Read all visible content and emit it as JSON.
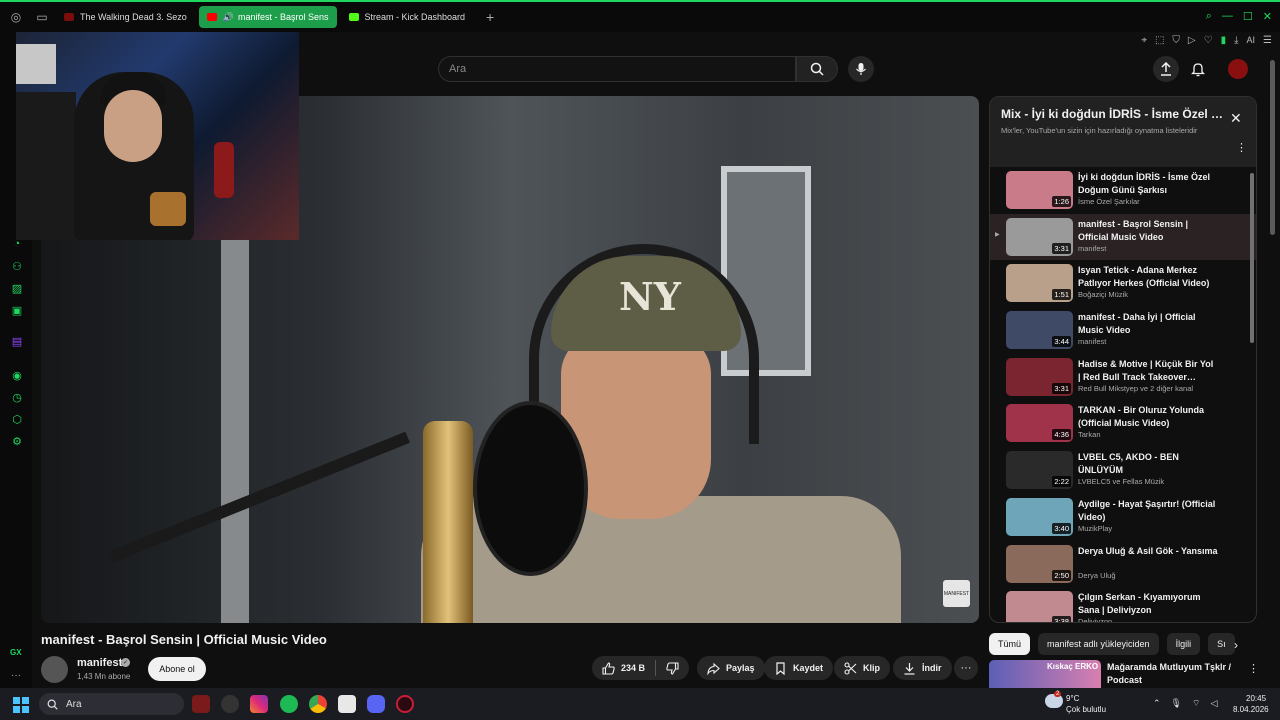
{
  "browser": {
    "tabs": [
      {
        "label": "The Walking Dead 3. Sezo",
        "active": false,
        "favicon_color": "#7a0c0c"
      },
      {
        "label": "manifest - Başrol Sens",
        "active": true,
        "favicon_color": "#ff0000"
      },
      {
        "label": "Stream - Kick Dashboard",
        "active": false,
        "favicon_color": "#53fc18"
      }
    ],
    "toolbar_ai_label": "AI",
    "accent": "#1fd65f"
  },
  "sidebar": {
    "gx_label": "GX",
    "more_label": "···"
  },
  "youtube": {
    "search_placeholder": "Ara",
    "video": {
      "title": "manifest - Başrol Sensin | Official Music Video",
      "watermark": "MANIFEST"
    },
    "channel": {
      "name": "manifest",
      "subscribers": "1,43 Mn abone",
      "subscribe_label": "Abone ol"
    },
    "actions": {
      "likes": "234 B",
      "share": "Paylaş",
      "save": "Kaydet",
      "clip": "Klip",
      "download": "İndir"
    },
    "mix": {
      "title": "Mix - İyi ki doğdun İDRİS - İsme Özel Doğum Günü Şarkısı",
      "subtitle": "Mix'ler, YouTube'un sizin için hazırladığı oynatma listeleridir",
      "items": [
        {
          "title": "İyi ki doğdun İDRİS - İsme Özel Doğum Günü Şarkısı",
          "channel": "İsme Özel Şarkılar",
          "duration": "1:26",
          "thumb": "#c97b8a",
          "current": false
        },
        {
          "title": "manifest - Başrol Sensin | Official Music Video",
          "channel": "manifest",
          "duration": "3:31",
          "thumb": "#9a9a9a",
          "current": true
        },
        {
          "title": "Isyan Tetick - Adana Merkez Patlıyor Herkes (Official Video)",
          "channel": "Boğaziçi Müzik",
          "duration": "1:51",
          "thumb": "#b9a08a",
          "current": false
        },
        {
          "title": "manifest - Daha İyi | Official Music Video",
          "channel": "manifest",
          "duration": "3:44",
          "thumb": "#3e4a66",
          "current": false
        },
        {
          "title": "Hadise & Motive | Küçük Bir Yol | Red Bull Track Takeover…",
          "channel": "Red Bull Mikstyep ve 2 diğer kanal",
          "duration": "3:31",
          "thumb": "#7a2530",
          "current": false
        },
        {
          "title": "TARKAN - Bir Oluruz Yolunda (Official Music Video)",
          "channel": "Tarkan",
          "duration": "4:36",
          "thumb": "#a0324a",
          "current": false
        },
        {
          "title": "LVBEL C5, AKDO - BEN ÜNLÜYÜM",
          "channel": "LVBELC5 ve Fellas Müzik",
          "duration": "2:22",
          "thumb": "#2a2a2a",
          "current": false
        },
        {
          "title": "Aydilge - Hayat Şaşırtır! (Official Video)",
          "channel": "MuzikPlay",
          "duration": "3:40",
          "thumb": "#6fa5b8",
          "current": false
        },
        {
          "title": "Derya Uluğ & Asil Gök - Yansıma",
          "channel": "Derya Uluğ",
          "duration": "2:50",
          "thumb": "#8a6a5a",
          "current": false
        },
        {
          "title": "Çılgın Serkan - Kıyamıyorum Sana | Deliviyzon",
          "channel": "Deliviyzon",
          "duration": "3:38",
          "thumb": "#c08a90",
          "current": false
        }
      ]
    },
    "chips": [
      "Tümü",
      "manifest adlı yükleyiciden",
      "İlgili",
      "Sı"
    ],
    "recommendation": {
      "title": "Mağaramda Mutluyum Tşklr / Podcast",
      "thumb_text": "Kıskaç ERKO"
    }
  },
  "taskbar": {
    "search_placeholder": "Ara",
    "weather_temp": "9°C",
    "weather_desc": "Çok bulutlu",
    "weather_badge": "2",
    "time": "20:45",
    "date": "8.04.2026"
  }
}
